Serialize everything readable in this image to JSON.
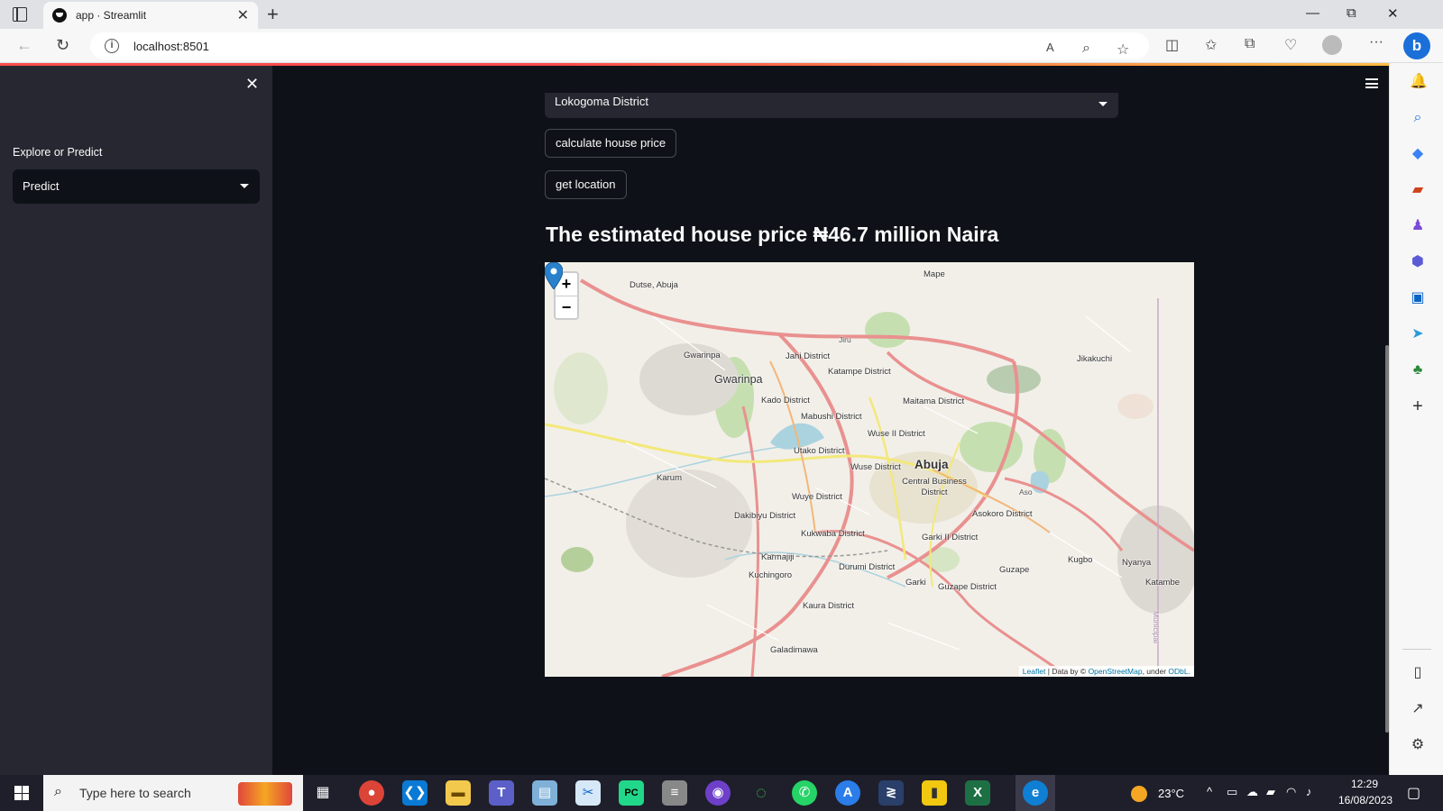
{
  "browser": {
    "tab_title": "app · Streamlit",
    "url": "localhost:8501",
    "new_tab": "+",
    "close_tab": "✕",
    "window_controls": {
      "minimize": "—",
      "restore": "⧉",
      "close": "✕"
    },
    "more_menu": "···",
    "bing_label": "b"
  },
  "sidebar": {
    "close": "✕",
    "label": "Explore or Predict",
    "select_value": "Predict"
  },
  "main": {
    "district_value": "Lokogoma District",
    "calculate_button": "calculate house price",
    "location_button": "get location",
    "result_heading": "The estimated house price ₦46.7 million Naira"
  },
  "map": {
    "zoom_in": "+",
    "zoom_out": "−",
    "places": [
      {
        "name": "Mape",
        "cls": ""
      },
      {
        "name": "Dutse, Abuja",
        "cls": ""
      },
      {
        "name": "Jiru",
        "cls": "small"
      },
      {
        "name": "Gwarinpa",
        "cls": ""
      },
      {
        "name": "Jahi District",
        "cls": ""
      },
      {
        "name": "Jikakuchi",
        "cls": ""
      },
      {
        "name": "Gwarinpa",
        "cls": "big"
      },
      {
        "name": "Katampe District",
        "cls": ""
      },
      {
        "name": "Kado District",
        "cls": ""
      },
      {
        "name": "Maitama District",
        "cls": ""
      },
      {
        "name": "Mabushi District",
        "cls": ""
      },
      {
        "name": "Wuse II District",
        "cls": ""
      },
      {
        "name": "Utako District",
        "cls": ""
      },
      {
        "name": "Wuse District",
        "cls": ""
      },
      {
        "name": "Abuja",
        "cls": "city"
      },
      {
        "name": "Karum",
        "cls": ""
      },
      {
        "name": "Central Business District",
        "cls": ""
      },
      {
        "name": "Aso",
        "cls": "small"
      },
      {
        "name": "Wuye District",
        "cls": ""
      },
      {
        "name": "Asokoro District",
        "cls": ""
      },
      {
        "name": "Dakibiyu District",
        "cls": ""
      },
      {
        "name": "Kukwaba District",
        "cls": ""
      },
      {
        "name": "Garki II District",
        "cls": ""
      },
      {
        "name": "Karmajiji",
        "cls": ""
      },
      {
        "name": "Kugbo",
        "cls": ""
      },
      {
        "name": "Nyanya",
        "cls": ""
      },
      {
        "name": "Durumi District",
        "cls": ""
      },
      {
        "name": "Guzape",
        "cls": ""
      },
      {
        "name": "Kuchingoro",
        "cls": ""
      },
      {
        "name": "Katambe",
        "cls": ""
      },
      {
        "name": "Garki",
        "cls": ""
      },
      {
        "name": "Guzape District",
        "cls": ""
      },
      {
        "name": "Kaura District",
        "cls": ""
      },
      {
        "name": "Galadimawa",
        "cls": ""
      },
      {
        "name": "Municipal",
        "cls": "small"
      }
    ],
    "attribution": {
      "leaflet": "Leaflet",
      "data_by": "| Data by ©",
      "osm": "OpenStreetMap",
      "under": ", under",
      "license": "ODbL."
    }
  },
  "taskbar": {
    "search_placeholder": "Type here to search",
    "temperature": "23°C",
    "time": "12:29",
    "date": "16/08/2023",
    "apps": [
      "chrome-icon",
      "vscode-icon",
      "file-explorer-icon",
      "teams-icon",
      "notepad-icon",
      "snipping-tool-icon",
      "pycharm-icon",
      "database-icon",
      "github-desktop-icon",
      "loader-icon",
      "whatsapp-icon",
      "app-store-icon",
      "terminal-icon",
      "power-bi-icon",
      "excel-icon",
      "edge-icon"
    ]
  },
  "colors": {
    "app_bg": "#0e1117",
    "sidebar_bg": "#262730",
    "accent": "#ff4b4b",
    "text": "#fafafa",
    "marker": "#2a81cb"
  }
}
